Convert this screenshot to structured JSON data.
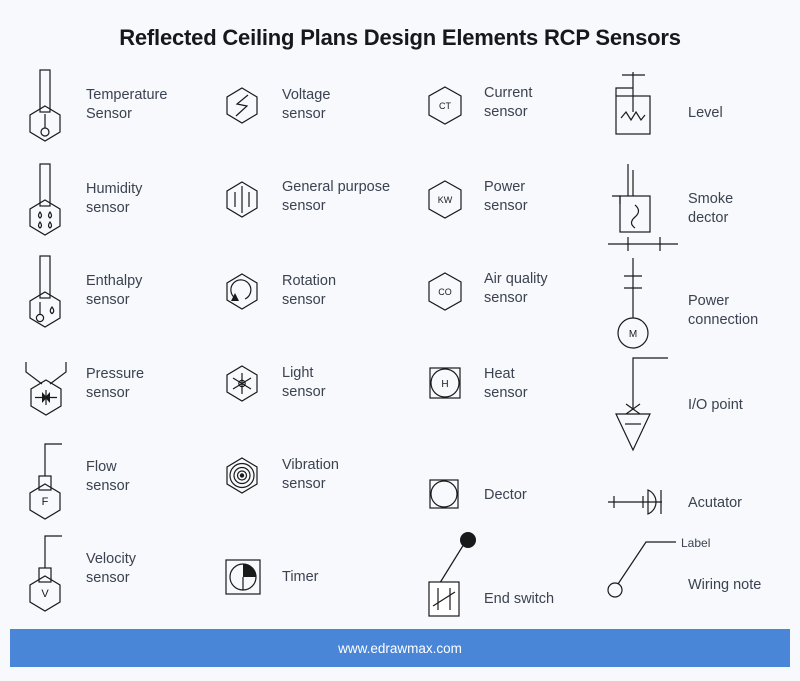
{
  "title": "Reflected Ceiling Plans Design Elements  RCP  Sensors",
  "footer": {
    "url": "www.edrawmax.com"
  },
  "colors": {
    "background": "#f7f9fc",
    "stroke": "#1a1a1a",
    "label_text": "#3b4250",
    "title_text": "#16181c",
    "footer_bar": "#4a86d8",
    "footer_text": "#ffffff"
  },
  "columns": [
    {
      "name": "column-1",
      "items": [
        {
          "icon": "temperature-sensor-symbol",
          "label": "Temperature\nSensor",
          "inner_text": ""
        },
        {
          "icon": "humidity-sensor-symbol",
          "label": "Humidity\nsensor",
          "inner_text": ""
        },
        {
          "icon": "enthalpy-sensor-symbol",
          "label": "Enthalpy\nsensor",
          "inner_text": ""
        },
        {
          "icon": "pressure-sensor-symbol",
          "label": "Pressure\nsensor",
          "inner_text": ""
        },
        {
          "icon": "flow-sensor-symbol",
          "label": "Flow\nsensor",
          "inner_text": "F"
        },
        {
          "icon": "velocity-sensor-symbol",
          "label": "Velocity\nsensor",
          "inner_text": "V"
        }
      ]
    },
    {
      "name": "column-2",
      "items": [
        {
          "icon": "voltage-sensor-symbol",
          "label": "Voltage\nsensor",
          "inner_text": ""
        },
        {
          "icon": "general-purpose-sensor-symbol",
          "label": "General purpose\nsensor",
          "inner_text": ""
        },
        {
          "icon": "rotation-sensor-symbol",
          "label": "Rotation\nsensor",
          "inner_text": ""
        },
        {
          "icon": "light-sensor-symbol",
          "label": "Light\nsensor",
          "inner_text": ""
        },
        {
          "icon": "vibration-sensor-symbol",
          "label": "Vibration\nsensor",
          "inner_text": ""
        },
        {
          "icon": "timer-symbol",
          "label": "Timer",
          "inner_text": ""
        }
      ]
    },
    {
      "name": "column-3",
      "items": [
        {
          "icon": "current-sensor-symbol",
          "label": "Current\nsensor",
          "inner_text": "CT"
        },
        {
          "icon": "power-sensor-symbol",
          "label": "Power\nsensor",
          "inner_text": "KW"
        },
        {
          "icon": "air-quality-sensor-symbol",
          "label": "Air quality\nsensor",
          "inner_text": "CO"
        },
        {
          "icon": "heat-sensor-symbol",
          "label": "Heat\nsensor",
          "inner_text": "H"
        },
        {
          "icon": "dector-symbol",
          "label": "Dector",
          "inner_text": ""
        },
        {
          "icon": "end-switch-symbol",
          "label": "End switch",
          "inner_text": ""
        }
      ]
    },
    {
      "name": "column-4",
      "items": [
        {
          "icon": "level-symbol",
          "label": "Level",
          "inner_text": ""
        },
        {
          "icon": "smoke-dector-symbol",
          "label": "Smoke\ndector",
          "inner_text": ""
        },
        {
          "icon": "power-connection-symbol",
          "label": "Power\nconnection",
          "inner_text": "M"
        },
        {
          "icon": "io-point-symbol",
          "label": "I/O point",
          "inner_text": ""
        },
        {
          "icon": "acutator-symbol",
          "label": "Acutator",
          "inner_text": ""
        },
        {
          "icon": "wiring-note-symbol",
          "label": "Wiring note",
          "inner_text": "Label"
        }
      ]
    }
  ]
}
